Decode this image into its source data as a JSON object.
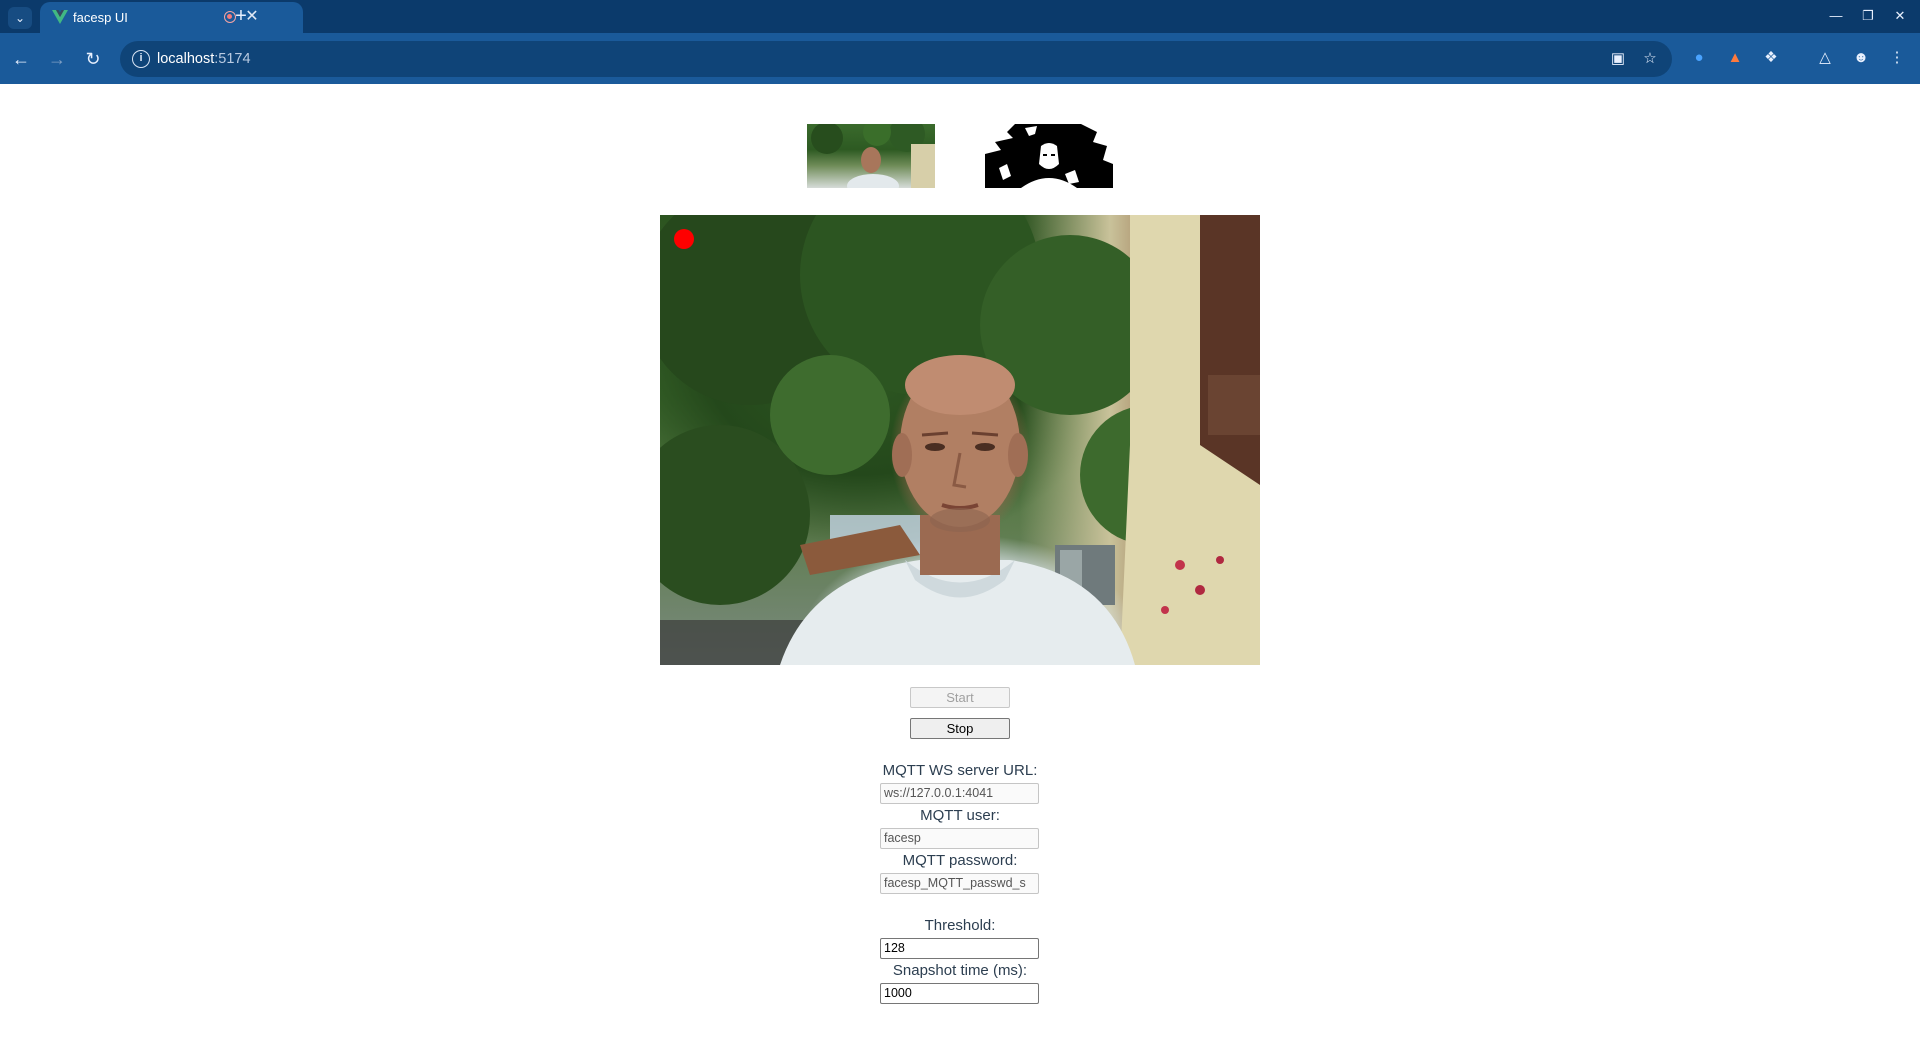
{
  "browser": {
    "tab_title": "facesp UI",
    "url_host": "localhost",
    "url_port": ":5174",
    "icons": {
      "tab_search": "chevron-down-icon",
      "recording": "recording-icon",
      "close": "close-icon",
      "new_tab": "plus-icon",
      "minimize": "minimize-icon",
      "restore": "restore-icon",
      "window_close": "close-icon",
      "back": "arrow-left-icon",
      "forward": "arrow-right-icon",
      "reload": "reload-icon",
      "site_info": "info-icon",
      "camera": "camera-icon",
      "bookmark": "star-icon",
      "extensions": "puzzle-icon",
      "labs": "flask-icon",
      "profile": "person-icon",
      "menu": "kebab-icon"
    }
  },
  "controls": {
    "start_label": "Start",
    "stop_label": "Stop"
  },
  "settings": {
    "mqtt_url_label": "MQTT WS server URL:",
    "mqtt_url_value": "ws://127.0.0.1:4041",
    "mqtt_user_label": "MQTT user:",
    "mqtt_user_value": "facesp",
    "mqtt_password_label": "MQTT password:",
    "mqtt_password_value": "facesp_MQTT_passwd_s",
    "threshold_label": "Threshold:",
    "threshold_value": "128",
    "snapshot_label": "Snapshot time (ms):",
    "snapshot_value": "1000"
  },
  "colors": {
    "chrome_dark": "#0b3a6b",
    "chrome": "#1a5a9a",
    "recording_dot": "#ff0000",
    "label_text": "#2c3e50"
  }
}
